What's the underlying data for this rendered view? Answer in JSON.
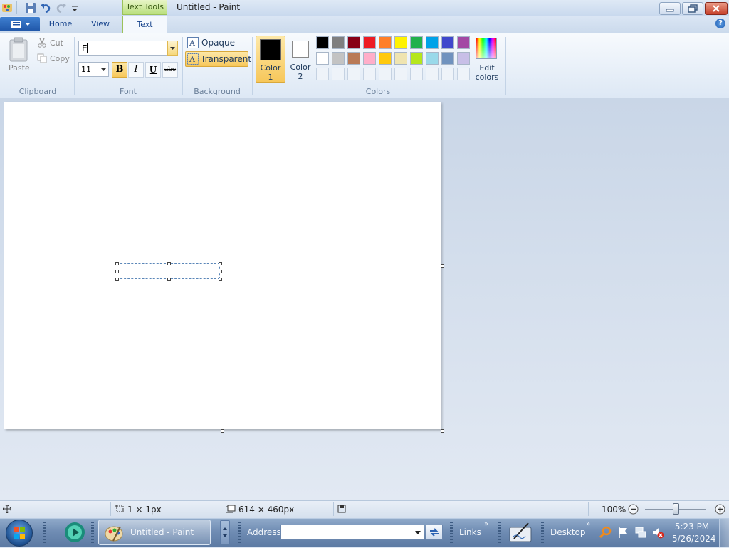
{
  "window": {
    "title": "Untitled - Paint",
    "context_tab": "Text Tools"
  },
  "tabs": [
    {
      "label": "Home"
    },
    {
      "label": "View"
    },
    {
      "label": "Text"
    }
  ],
  "ribbon": {
    "clipboard": {
      "paste": "Paste",
      "cut": "Cut",
      "copy": "Copy",
      "group_label": "Clipboard"
    },
    "font": {
      "family_value": "E",
      "size_value": "11",
      "bold": "B",
      "italic": "I",
      "underline": "U",
      "strike": "abc",
      "group_label": "Font"
    },
    "background": {
      "opaque": "Opaque",
      "transparent": "Transparent",
      "group_label": "Background"
    },
    "colors": {
      "color1_line1": "Color",
      "color1_line2": "1",
      "color2_line1": "Color",
      "color2_line2": "2",
      "edit_line1": "Edit",
      "edit_line2": "colors",
      "group_label": "Colors",
      "color1": "#000000",
      "color2": "#ffffff",
      "palette_row1": [
        "#000000",
        "#7f7f7f",
        "#880015",
        "#ed1c24",
        "#ff7f27",
        "#fff200",
        "#22b14c",
        "#00a2e8",
        "#3f48cc",
        "#a349a4"
      ],
      "palette_row2": [
        "#ffffff",
        "#c3c3c3",
        "#b97a57",
        "#ffaec9",
        "#ffc90e",
        "#efe4b0",
        "#b5e61d",
        "#99d9ea",
        "#7092be",
        "#c8bfe7"
      ]
    }
  },
  "statusbar": {
    "selection_size": "1 × 1px",
    "canvas_size": "614 × 460px",
    "zoom": "100%"
  },
  "taskbar": {
    "active_app": "Untitled - Paint",
    "address_label": "Address",
    "address_value": "",
    "links_label": "Links",
    "desktop_label": "Desktop",
    "time": "5:23 PM",
    "date": "5/26/2024"
  }
}
